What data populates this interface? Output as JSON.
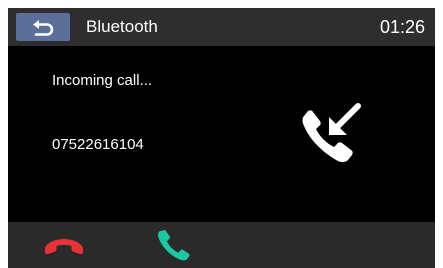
{
  "header": {
    "back_icon": "back-return-icon",
    "title": "Bluetooth",
    "time": "01:26"
  },
  "call": {
    "status": "Incoming call...",
    "number": "07522616104",
    "status_icon": "incoming-call-icon"
  },
  "actions": {
    "decline_icon": "hang-up-icon",
    "answer_icon": "answer-call-icon"
  },
  "colors": {
    "header_bg": "#2e2e2e",
    "back_button_bg": "#5b6f9a",
    "screen_bg": "#000000",
    "bottom_bar_bg": "#2a2a2a",
    "decline": "#e8323a",
    "answer": "#19c9a0",
    "text": "#ffffff"
  }
}
